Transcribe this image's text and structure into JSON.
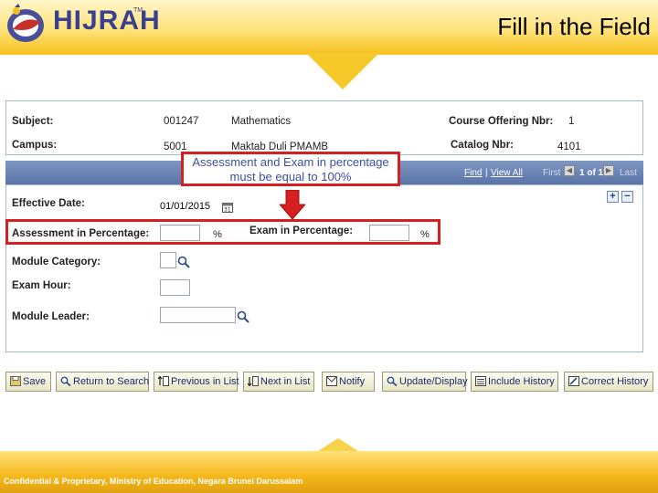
{
  "slide": {
    "title": "Fill in the Field",
    "logo_text": "HIJRAH",
    "logo_tm": "TM",
    "footer": "Confidential & Proprietary, Ministry of Education, Negara Brunei Darussalam"
  },
  "info": {
    "subject_label": "Subject:",
    "subject_code": "001247",
    "subject_name": "Mathematics",
    "course_offering_label": "Course Offering Nbr:",
    "course_offering_value": "1",
    "campus_label": "Campus:",
    "campus_code": "5001",
    "campus_name": "Maktab Duli PMAMB",
    "catalog_label": "Catalog Nbr:",
    "catalog_value": "4101"
  },
  "grid_nav": {
    "find": "Find",
    "separator": "|",
    "view_all": "View All",
    "first": "First",
    "count": "1 of 1",
    "last": "Last"
  },
  "form": {
    "effective_date_label": "Effective Date:",
    "effective_date_value": "01/01/2015",
    "assessment_label": "Assessment in Percentage:",
    "assessment_value": "",
    "exam_pct_label": "Exam in Percentage:",
    "exam_pct_value": "",
    "percent_symbol": "%",
    "module_category_label": "Module Category:",
    "module_category_value": "",
    "exam_hour_label": "Exam Hour:",
    "exam_hour_value": "",
    "module_leader_label": "Module Leader:",
    "module_leader_value": "",
    "add_row": "+",
    "delete_row": "−"
  },
  "annotation": {
    "callout_text": "Assessment and Exam in percentage must be equal to 100%",
    "color": "#d42020"
  },
  "toolbar": {
    "save": "Save",
    "return_to_search": "Return to Search",
    "previous_in_list": "Previous in List",
    "next_in_list": "Next in List",
    "notify": "Notify",
    "update_display": "Update/Display",
    "include_history": "Include History",
    "correct_history": "Correct History"
  },
  "colors": {
    "band_gold": "#f5c21c",
    "grid_header_blue": "#5a74a8",
    "brand_navy": "#3b3f8f"
  }
}
